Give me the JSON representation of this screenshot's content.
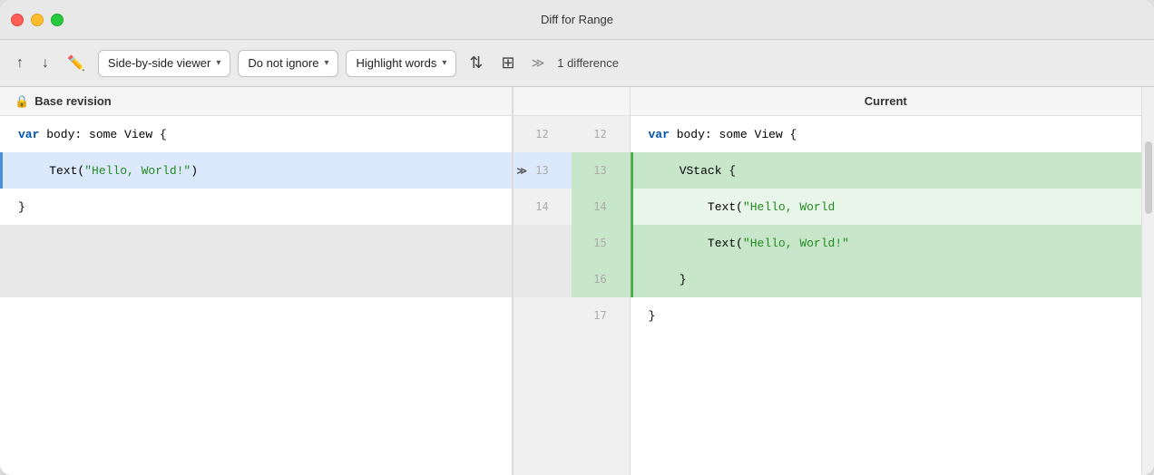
{
  "window": {
    "title": "Diff for Range"
  },
  "traffic_lights": {
    "close": "close",
    "minimize": "minimize",
    "maximize": "maximize"
  },
  "toolbar": {
    "up_label": "↑",
    "down_label": "↓",
    "edit_label": "✏",
    "viewer_label": "Side-by-side viewer",
    "ignore_label": "Do not ignore",
    "highlight_label": "Highlight words",
    "collapse_icon": "⇅",
    "columns_icon": "⊞",
    "chevrons_label": "≫",
    "diff_count": "1 difference"
  },
  "left_panel": {
    "header": "Base revision",
    "lines": [
      {
        "content": "var body: some View {",
        "type": "normal"
      },
      {
        "content": "    Text(\"Hello, World!\")",
        "type": "changed"
      },
      {
        "content": "}",
        "type": "normal"
      }
    ]
  },
  "right_panel": {
    "header": "Current",
    "lines": [
      {
        "content": "var body: some View {",
        "type": "normal"
      },
      {
        "content": "    VStack {",
        "type": "added"
      },
      {
        "content": "        Text(\"Hello, World",
        "type": "added-highlight"
      },
      {
        "content": "        Text(\"Hello, World!\"",
        "type": "added"
      },
      {
        "content": "    }",
        "type": "added"
      },
      {
        "content": "}",
        "type": "normal"
      }
    ]
  },
  "gutter": {
    "left_numbers": [
      "12",
      "13",
      "14",
      "",
      "",
      ""
    ],
    "right_numbers": [
      "12",
      "13",
      "14",
      "15",
      "16",
      "17"
    ]
  }
}
